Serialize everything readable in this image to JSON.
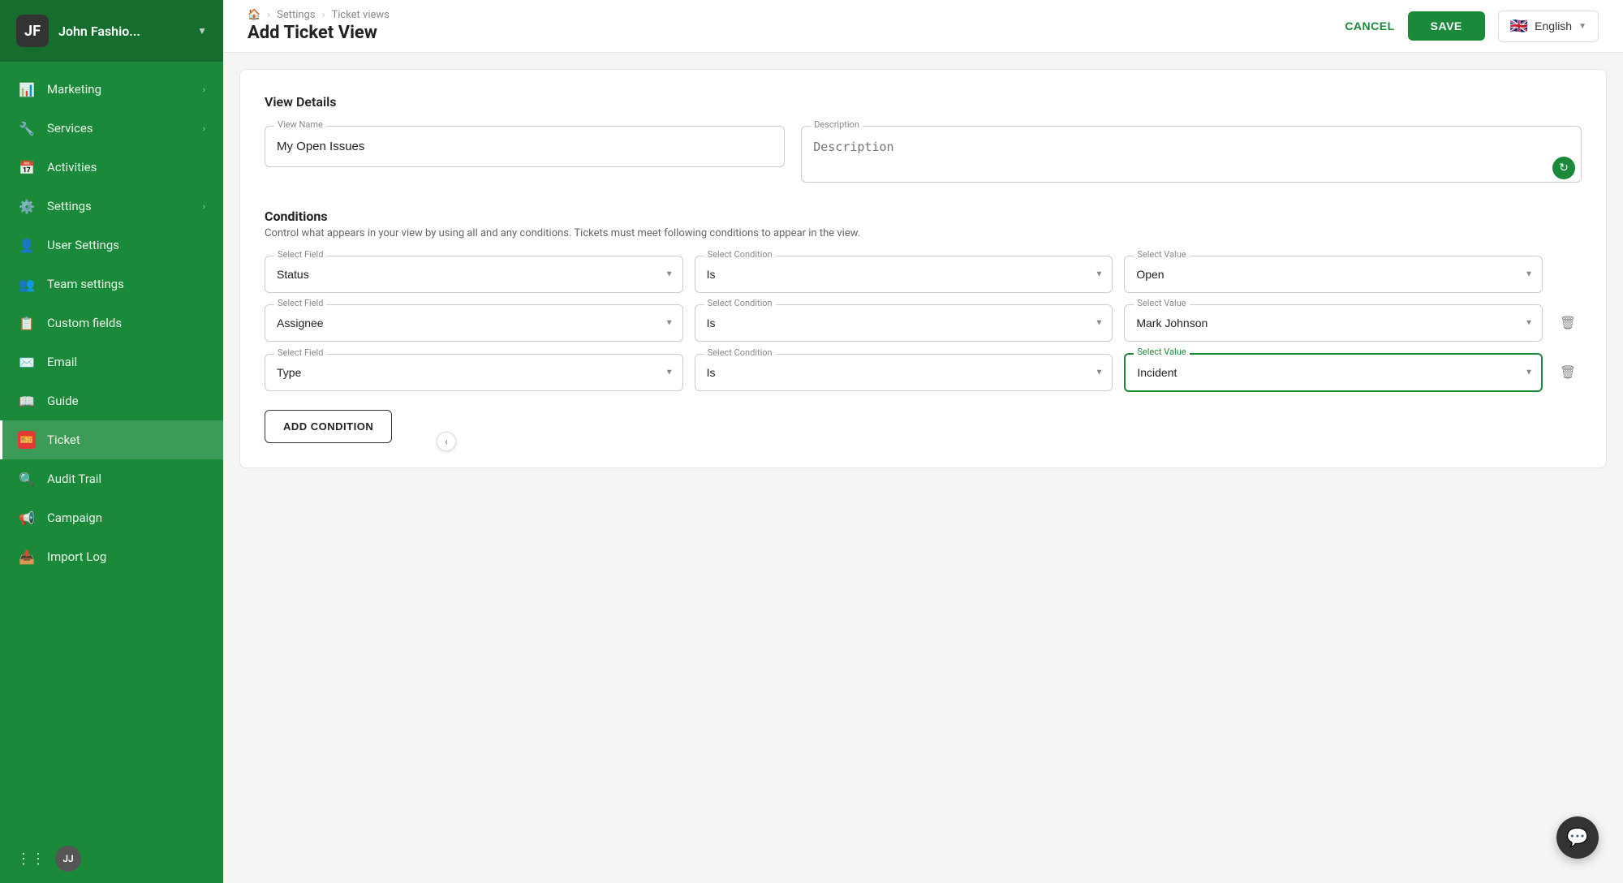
{
  "brand": {
    "name": "John Fashio...",
    "logo_text": "JF",
    "chevron": "▼"
  },
  "sidebar": {
    "items": [
      {
        "id": "marketing",
        "label": "Marketing",
        "icon": "📊",
        "has_arrow": true,
        "active": false
      },
      {
        "id": "services",
        "label": "Services",
        "icon": "🔧",
        "has_arrow": true,
        "active": false
      },
      {
        "id": "activities",
        "label": "Activities",
        "icon": "📅",
        "has_arrow": false,
        "active": false
      },
      {
        "id": "settings",
        "label": "Settings",
        "icon": "⚙️",
        "has_arrow": true,
        "active": false
      },
      {
        "id": "user-settings",
        "label": "User Settings",
        "icon": "👤",
        "has_arrow": false,
        "active": false
      },
      {
        "id": "team-settings",
        "label": "Team settings",
        "icon": "👥",
        "has_arrow": false,
        "active": false
      },
      {
        "id": "custom-fields",
        "label": "Custom fields",
        "icon": "📋",
        "has_arrow": false,
        "active": false
      },
      {
        "id": "email",
        "label": "Email",
        "icon": "✉️",
        "has_arrow": false,
        "active": false
      },
      {
        "id": "guide",
        "label": "Guide",
        "icon": "📖",
        "has_arrow": false,
        "active": false
      },
      {
        "id": "ticket",
        "label": "Ticket",
        "icon": "🎫",
        "has_arrow": false,
        "active": true
      },
      {
        "id": "audit-trail",
        "label": "Audit Trail",
        "icon": "🔍",
        "has_arrow": false,
        "active": false
      },
      {
        "id": "campaign",
        "label": "Campaign",
        "icon": "📢",
        "has_arrow": false,
        "active": false
      },
      {
        "id": "import-log",
        "label": "Import Log",
        "icon": "📥",
        "has_arrow": false,
        "active": false
      }
    ],
    "avatar_initials": "JJ"
  },
  "topbar": {
    "breadcrumb": {
      "home": "🏠",
      "settings": "Settings",
      "ticket_views": "Ticket views"
    },
    "page_title": "Add Ticket View",
    "cancel_label": "CANCEL",
    "save_label": "SAVE",
    "language": "English",
    "flag": "🇬🇧"
  },
  "form": {
    "view_details_title": "View Details",
    "view_name_label": "View Name",
    "view_name_value": "My Open Issues",
    "description_label": "Description",
    "description_placeholder": "Description"
  },
  "conditions": {
    "title": "Conditions",
    "description": "Control what appears in your view by using all and any conditions. Tickets must meet following conditions to appear in the view.",
    "rows": [
      {
        "id": 1,
        "field_label": "Select Field",
        "field_value": "Status",
        "condition_label": "Select Condition",
        "condition_value": "Is",
        "value_label": "Select Value",
        "value_value": "Open",
        "deletable": false,
        "active": false
      },
      {
        "id": 2,
        "field_label": "Select Field",
        "field_value": "Assignee",
        "condition_label": "Select Condition",
        "condition_value": "Is",
        "value_label": "Select Value",
        "value_value": "Mark Johnson",
        "deletable": true,
        "active": false
      },
      {
        "id": 3,
        "field_label": "Select Field",
        "field_value": "Type",
        "condition_label": "Select Condition",
        "condition_value": "Is",
        "value_label": "Select Value",
        "value_value": "Incident",
        "deletable": true,
        "active": true
      }
    ],
    "add_condition_label": "ADD CONDITION"
  },
  "chat": {
    "icon": "💬"
  }
}
